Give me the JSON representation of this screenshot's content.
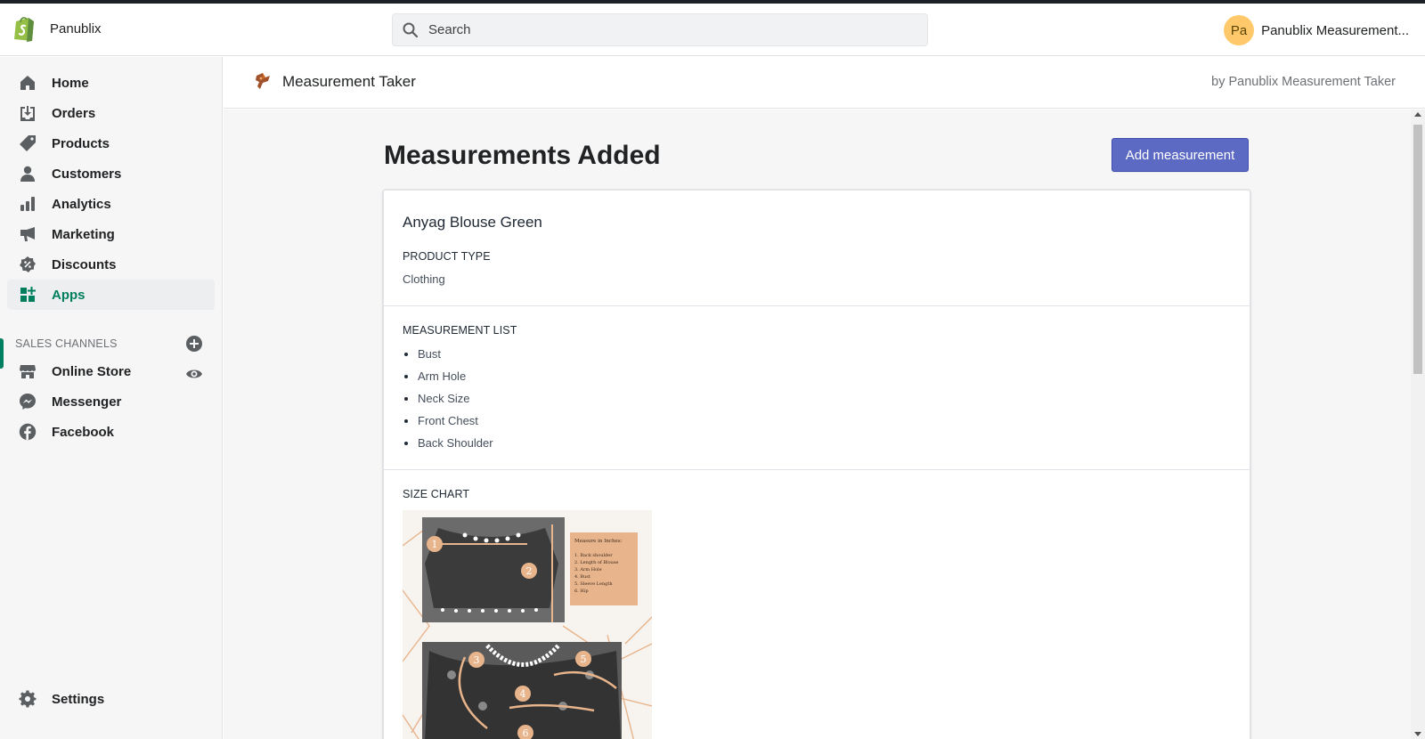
{
  "store": {
    "name": "Panublix"
  },
  "search": {
    "placeholder": "Search"
  },
  "account": {
    "initials": "Pa",
    "name": "Panublix Measurement..."
  },
  "sidebar": {
    "items": [
      {
        "label": "Home",
        "icon": "home-icon"
      },
      {
        "label": "Orders",
        "icon": "orders-icon"
      },
      {
        "label": "Products",
        "icon": "tag-icon"
      },
      {
        "label": "Customers",
        "icon": "person-icon"
      },
      {
        "label": "Analytics",
        "icon": "bar-chart-icon"
      },
      {
        "label": "Marketing",
        "icon": "megaphone-icon"
      },
      {
        "label": "Discounts",
        "icon": "discount-icon"
      },
      {
        "label": "Apps",
        "icon": "apps-icon",
        "active": true
      }
    ],
    "sales_channels_title": "SALES CHANNELS",
    "channels": [
      {
        "label": "Online Store",
        "icon": "store-icon"
      },
      {
        "label": "Messenger",
        "icon": "messenger-icon"
      },
      {
        "label": "Facebook",
        "icon": "facebook-icon"
      }
    ],
    "settings_label": "Settings"
  },
  "app": {
    "name": "Measurement Taker",
    "by": "by Panublix Measurement Taker"
  },
  "page": {
    "title": "Measurements Added",
    "add_button": "Add measurement"
  },
  "product": {
    "name": "Anyag Blouse Green",
    "type_label": "PRODUCT TYPE",
    "type_value": "Clothing",
    "measurement_label": "MEASUREMENT LIST",
    "measurements": [
      "Bust",
      "Arm Hole",
      "Neck Size",
      "Front Chest",
      "Back Shoulder"
    ],
    "size_chart_label": "SIZE CHART",
    "size_chart": {
      "heading": "Measure in Inches:",
      "items": [
        "1. Back shoulder",
        "2. Length of Blouse",
        "3. Arm Hole",
        "4. Bust",
        "5. Sleeve Length",
        "6. Hip"
      ],
      "markers": [
        "1",
        "2",
        "3",
        "4",
        "5",
        "6"
      ]
    }
  },
  "colors": {
    "accent": "#5c6ac4",
    "active_nav": "#007f5f",
    "avatar": "#ffc96b",
    "brand_green": "#95bf47"
  }
}
